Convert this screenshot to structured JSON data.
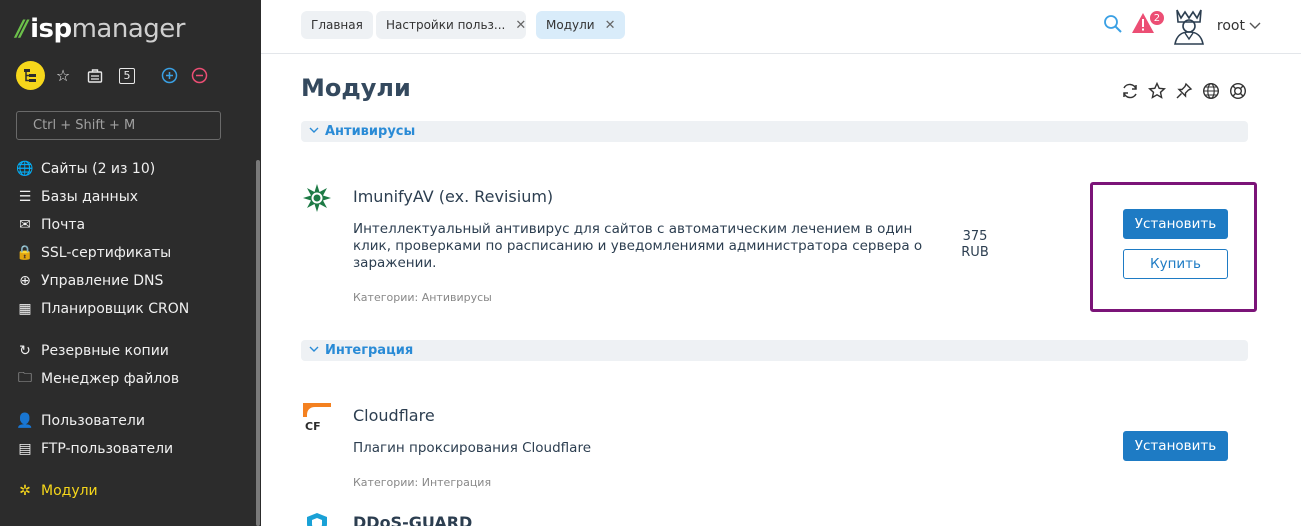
{
  "brand": {
    "mark": "//",
    "isp": "isp",
    "manager": "manager"
  },
  "quick": {
    "star": "☆",
    "badge_num": "5"
  },
  "side_search": {
    "placeholder": "Ctrl + Shift + M"
  },
  "nav": [
    {
      "label": "Сайты (2 из 10)",
      "icon": "globe-icon",
      "glyph": "🌐"
    },
    {
      "label": "Базы данных",
      "icon": "database-icon",
      "glyph": "☰"
    },
    {
      "label": "Почта",
      "icon": "envelope-icon",
      "glyph": "✉"
    },
    {
      "label": "SSL-сертификаты",
      "icon": "lock-icon",
      "glyph": "🔒"
    },
    {
      "label": "Управление DNS",
      "icon": "dns-icon",
      "glyph": "⊕"
    },
    {
      "label": "Планировщик CRON",
      "icon": "calendar-icon",
      "glyph": "▦"
    },
    {
      "label": "Резервные копии",
      "icon": "backup-icon",
      "glyph": "↻"
    },
    {
      "label": "Менеджер файлов",
      "icon": "folder-icon",
      "glyph": "🗀"
    },
    {
      "label": "Пользователи",
      "icon": "user-icon",
      "glyph": "👤"
    },
    {
      "label": "FTP-пользователи",
      "icon": "ftp-icon",
      "glyph": "▤"
    },
    {
      "label": "Модули",
      "icon": "puzzle-icon",
      "glyph": "✲"
    }
  ],
  "tabs": [
    {
      "label": "Главная"
    },
    {
      "label": "Настройки польз...",
      "close": "✕"
    },
    {
      "label": "Модули",
      "close": "✕"
    }
  ],
  "header": {
    "alert_count": "2",
    "user": "root"
  },
  "page": {
    "title": "Модули"
  },
  "sections": [
    {
      "label": "Антивирусы"
    },
    {
      "label": "Интеграция"
    }
  ],
  "modules": [
    {
      "title": "ImunifyAV (ex. Revisium)",
      "description": "Интеллектуальный антивирус для сайтов с автоматическим лечением в один клик, проверками по расписанию и уведомлениями администратора сервера о заражении.",
      "category": "Категории: Антивирусы",
      "price": "375",
      "currency": "RUB",
      "install_label": "Установить",
      "buy_label": "Купить"
    },
    {
      "title": "Cloudflare",
      "description": "Плагин проксирования Cloudflare",
      "category": "Категории: Интеграция",
      "install_label": "Установить"
    },
    {
      "title": "DDoS-GUARD"
    }
  ],
  "colors": {
    "accent": "#1e7bc4",
    "sidebar": "#2c2c2c",
    "active": "#f6d71b",
    "highlight": "#7b1478"
  }
}
